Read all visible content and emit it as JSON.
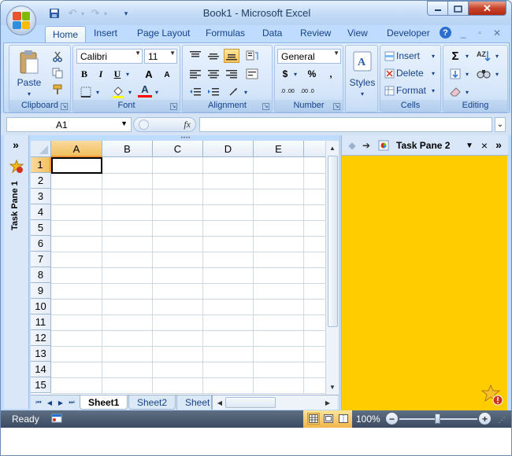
{
  "window": {
    "title": "Book1 - Microsoft Excel"
  },
  "tabs": [
    "Home",
    "Insert",
    "Page Layout",
    "Formulas",
    "Data",
    "Review",
    "View",
    "Developer"
  ],
  "ribbon": {
    "clipboard": {
      "label": "Clipboard",
      "paste": "Paste"
    },
    "font": {
      "label": "Font",
      "name": "Calibri",
      "size": "11",
      "bold": "B",
      "italic": "I",
      "underline": "U",
      "grow": "A",
      "shrink": "A",
      "color_letter": "A"
    },
    "alignment": {
      "label": "Alignment"
    },
    "number": {
      "label": "Number",
      "format": "General",
      "currency": "$",
      "percent": "%",
      "comma": ",",
      "inc_decimal": ".0 .00",
      "dec_decimal": ".00 .0"
    },
    "styles": {
      "label": "Styles"
    },
    "cells": {
      "label": "Cells",
      "insert": "Insert",
      "delete": "Delete",
      "format": "Format"
    },
    "editing": {
      "label": "Editing",
      "sigma": "Σ"
    }
  },
  "formula_bar": {
    "name_box": "A1",
    "fx": "fx",
    "value": ""
  },
  "left_pane": {
    "label": "Task Pane 1",
    "expand": "»"
  },
  "right_pane": {
    "label": "Task Pane 2",
    "expand": "»",
    "close": "×"
  },
  "columns": [
    "A",
    "B",
    "C",
    "D",
    "E"
  ],
  "rows": [
    "1",
    "2",
    "3",
    "4",
    "5",
    "6",
    "7",
    "8",
    "9",
    "10",
    "11",
    "12",
    "13",
    "14",
    "15"
  ],
  "sheets": [
    "Sheet1",
    "Sheet2",
    "Sheet"
  ],
  "status": {
    "ready": "Ready",
    "zoom": "100%"
  },
  "colors": {
    "task_pane_2": "#ffcc00",
    "status_bar": "#3b4a60",
    "selection": "#f29536"
  }
}
